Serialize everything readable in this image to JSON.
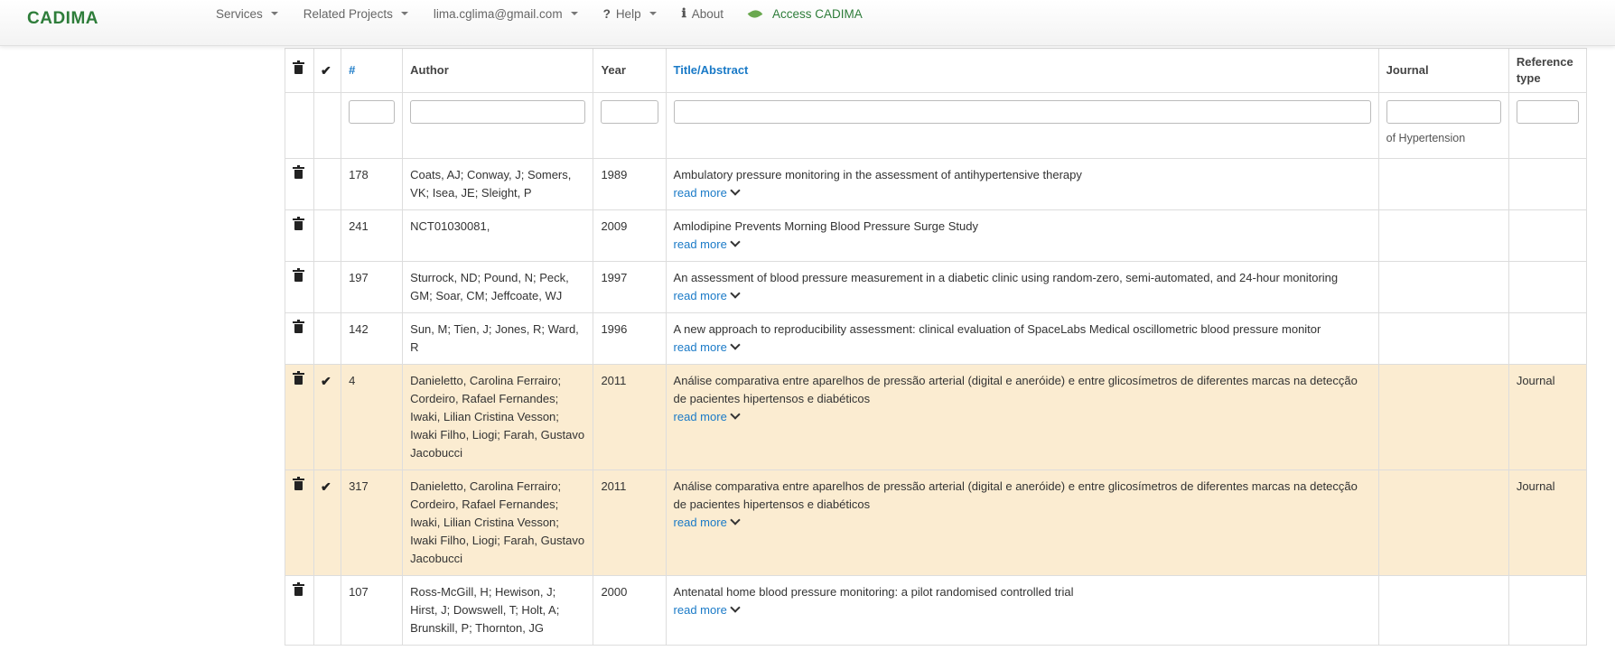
{
  "nav": {
    "brand": "CADIMA",
    "items": [
      {
        "name": "nav-services",
        "label": "Services",
        "caret": true
      },
      {
        "name": "nav-related-projects",
        "label": "Related Projects",
        "caret": true
      },
      {
        "name": "nav-user",
        "label": "lima.cglima@gmail.com",
        "caret": true
      },
      {
        "name": "nav-help",
        "label": "Help",
        "icon": "?",
        "caret": true
      },
      {
        "name": "nav-about",
        "label": "About",
        "icon": "ℹ",
        "caret": false
      },
      {
        "name": "nav-access",
        "label": "Access CADIMA",
        "caret": false
      }
    ]
  },
  "table": {
    "headers": {
      "num": "#",
      "author": "Author",
      "year": "Year",
      "title": "Title/Abstract",
      "journal": "Journal",
      "reftype": "Reference type"
    },
    "journal_filter_hint": "of Hypertension",
    "read_more": "read more",
    "rows": [
      {
        "num": "178",
        "author": "Coats, AJ; Conway, J; Somers, VK; Isea, JE; Sleight, P",
        "year": "1989",
        "title": "Ambulatory pressure monitoring in the assessment of antihypertensive therapy",
        "journal": "",
        "reftype": "",
        "checked": false,
        "selected": false
      },
      {
        "num": "241",
        "author": "NCT01030081,",
        "year": "2009",
        "title": "Amlodipine Prevents Morning Blood Pressure Surge Study",
        "journal": "",
        "reftype": "",
        "checked": false,
        "selected": false
      },
      {
        "num": "197",
        "author": "Sturrock, ND; Pound, N; Peck, GM; Soar, CM; Jeffcoate, WJ",
        "year": "1997",
        "title": "An assessment of blood pressure measurement in a diabetic clinic using random-zero, semi-automated, and 24-hour monitoring",
        "journal": "",
        "reftype": "",
        "checked": false,
        "selected": false
      },
      {
        "num": "142",
        "author": "Sun, M; Tien, J; Jones, R; Ward, R",
        "year": "1996",
        "title": "A new approach to reproducibility assessment: clinical evaluation of SpaceLabs Medical oscillometric blood pressure monitor",
        "journal": "",
        "reftype": "",
        "checked": false,
        "selected": false
      },
      {
        "num": "4",
        "author": "Danieletto, Carolina Ferrairo; Cordeiro, Rafael Fernandes; Iwaki, Lilian Cristina Vesson; Iwaki Filho, Liogi; Farah, Gustavo Jacobucci",
        "year": "2011",
        "title": "Análise comparativa entre aparelhos de pressão arterial (digital e aneróide) e entre glicosímetros de diferentes marcas na detecção de pacientes hipertensos e diabéticos",
        "journal": "",
        "reftype": "Journal",
        "checked": true,
        "selected": true
      },
      {
        "num": "317",
        "author": "Danieletto, Carolina Ferrairo; Cordeiro, Rafael Fernandes; Iwaki, Lilian Cristina Vesson; Iwaki Filho, Liogi; Farah, Gustavo Jacobucci",
        "year": "2011",
        "title": "Análise comparativa entre aparelhos de pressão arterial (digital e aneróide) e entre glicosímetros de diferentes marcas na detecção de pacientes hipertensos e diabéticos",
        "journal": "",
        "reftype": "Journal",
        "checked": true,
        "selected": true
      },
      {
        "num": "107",
        "author": "Ross-McGill, H; Hewison, J; Hirst, J; Dowswell, T; Holt, A; Brunskill, P; Thornton, JG",
        "year": "2000",
        "title": "Antenatal home blood pressure monitoring: a pilot randomised controlled trial",
        "journal": "",
        "reftype": "",
        "checked": false,
        "selected": false
      }
    ]
  },
  "colors": {
    "accent": "#1a7ac7",
    "brand": "#2e7d3a",
    "selected_row": "#fbecd1"
  }
}
